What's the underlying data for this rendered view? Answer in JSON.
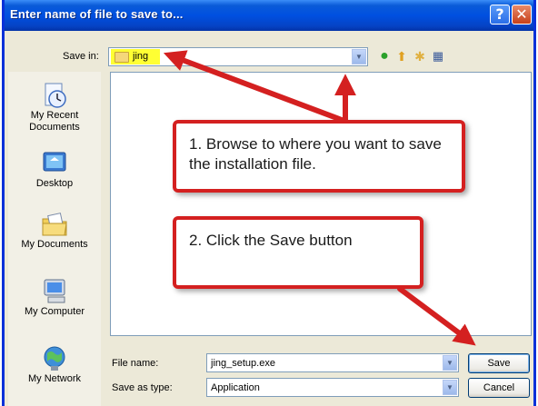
{
  "dialog": {
    "title": "Enter name of file to save to...",
    "help_glyph": "?",
    "close_glyph": "✕"
  },
  "save_in": {
    "label": "Save in:",
    "value": "jing"
  },
  "toolbar_icons": [
    "back-icon",
    "up-folder-icon",
    "new-folder-icon",
    "views-menu-icon"
  ],
  "places": [
    {
      "label": "My Recent Documents",
      "icon": "recent-documents-icon"
    },
    {
      "label": "Desktop",
      "icon": "desktop-icon"
    },
    {
      "label": "My Documents",
      "icon": "my-documents-icon"
    },
    {
      "label": "My Computer",
      "icon": "my-computer-icon"
    },
    {
      "label": "My Network",
      "icon": "my-network-icon"
    }
  ],
  "file_name": {
    "label": "File name:",
    "value": "jing_setup.exe"
  },
  "save_as_type": {
    "label": "Save as type:",
    "value": "Application"
  },
  "buttons": {
    "save": "Save",
    "cancel": "Cancel"
  },
  "annotations": {
    "step1": "1. Browse to where you want to save the installation file.",
    "step2": "2. Click the Save button"
  },
  "colors": {
    "title_bar": "#0050e0",
    "annotation_red": "#d42020",
    "highlight_yellow": "#ffff33"
  }
}
